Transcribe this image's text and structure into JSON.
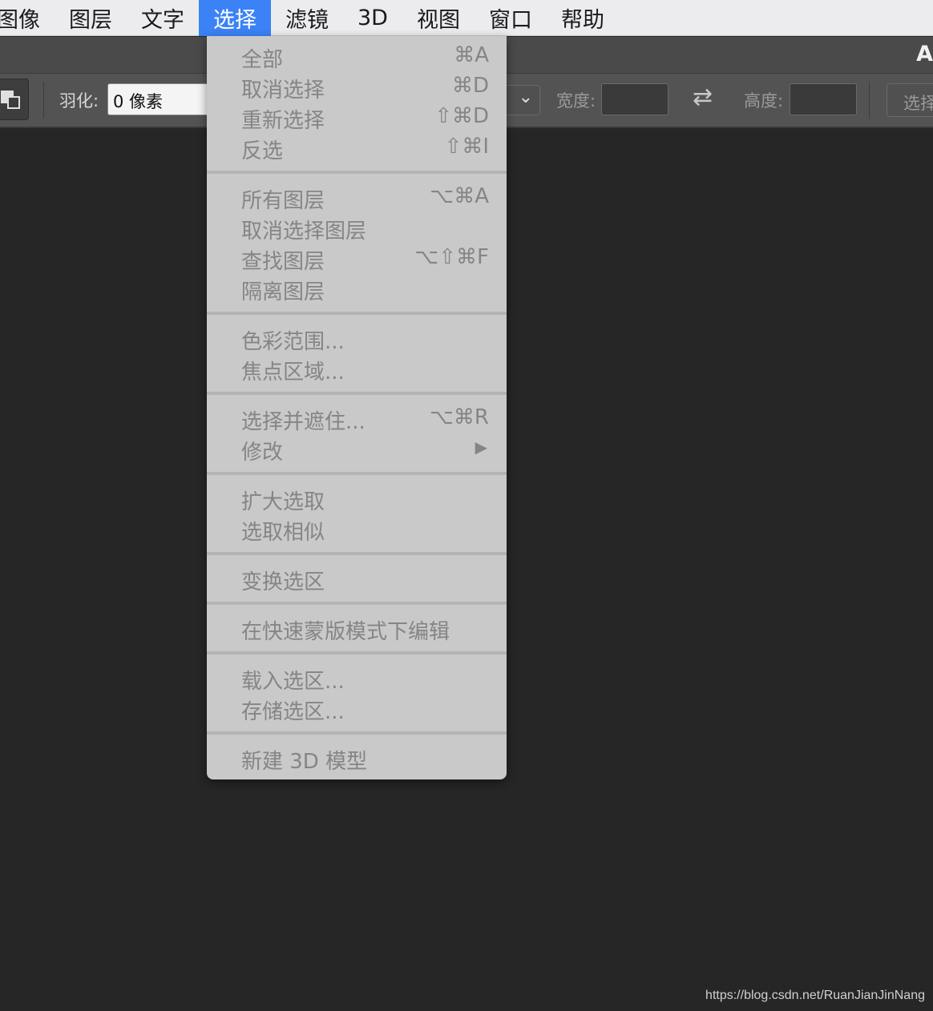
{
  "menubar": {
    "items": [
      "图像",
      "图层",
      "文字",
      "选择",
      "滤镜",
      "3D",
      "视图",
      "窗口",
      "帮助"
    ],
    "active": "选择"
  },
  "titlebar": {
    "title": "A"
  },
  "options": {
    "feather_label": "羽化:",
    "feather_value": "0 像素",
    "width_label": "宽度:",
    "height_label": "高度:",
    "swap_icon": "swap-arrows-icon",
    "select_button_label": "选择"
  },
  "select_menu": {
    "groups": [
      [
        {
          "label": "全部",
          "shortcut": "⌘A"
        },
        {
          "label": "取消选择",
          "shortcut": "⌘D"
        },
        {
          "label": "重新选择",
          "shortcut": "⇧⌘D"
        },
        {
          "label": "反选",
          "shortcut": "⇧⌘I"
        }
      ],
      [
        {
          "label": "所有图层",
          "shortcut": "⌥⌘A"
        },
        {
          "label": "取消选择图层",
          "shortcut": ""
        },
        {
          "label": "查找图层",
          "shortcut": "⌥⇧⌘F"
        },
        {
          "label": "隔离图层",
          "shortcut": ""
        }
      ],
      [
        {
          "label": "色彩范围...",
          "shortcut": ""
        },
        {
          "label": "焦点区域...",
          "shortcut": ""
        }
      ],
      [
        {
          "label": "选择并遮住...",
          "shortcut": "⌥⌘R"
        },
        {
          "label": "修改",
          "shortcut": "",
          "submenu": true
        }
      ],
      [
        {
          "label": "扩大选取",
          "shortcut": ""
        },
        {
          "label": "选取相似",
          "shortcut": ""
        }
      ],
      [
        {
          "label": "变换选区",
          "shortcut": ""
        }
      ],
      [
        {
          "label": "在快速蒙版模式下编辑",
          "shortcut": ""
        }
      ],
      [
        {
          "label": "载入选区...",
          "shortcut": ""
        },
        {
          "label": "存储选区...",
          "shortcut": ""
        }
      ],
      [
        {
          "label": "新建 3D 模型",
          "shortcut": ""
        }
      ]
    ]
  },
  "watermark": "https://blog.csdn.net/RuanJianJinNang"
}
